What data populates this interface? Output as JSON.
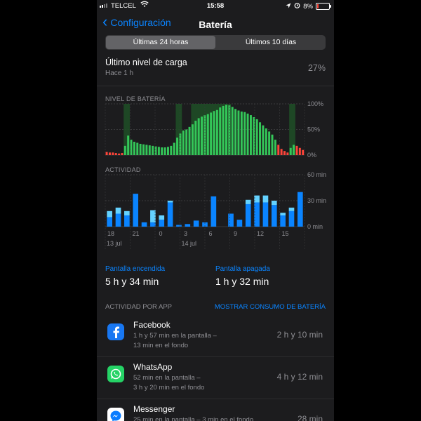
{
  "status": {
    "carrier": "TELCEL",
    "time": "15:58",
    "battery": "8%"
  },
  "nav": {
    "back_label": "Configuración",
    "title": "Batería"
  },
  "segments": {
    "last24": "Últimas 24 horas",
    "last10": "Últimos 10 días"
  },
  "charge": {
    "title": "Último nivel de carga",
    "subtitle": "Hace 1 h",
    "value": "27%"
  },
  "chart_data": [
    {
      "type": "bar",
      "title": "NIVEL DE BATERÍA",
      "ylim": [
        0,
        100
      ],
      "yticks": [
        "100%",
        "50%",
        "0%"
      ],
      "values": [
        6,
        5,
        5,
        4,
        3,
        4,
        18,
        38,
        30,
        26,
        24,
        22,
        21,
        20,
        19,
        18,
        17,
        16,
        15,
        15,
        16,
        18,
        24,
        34,
        42,
        48,
        50,
        55,
        60,
        67,
        72,
        75,
        78,
        80,
        83,
        86,
        88,
        93,
        96,
        98,
        97,
        94,
        90,
        87,
        85,
        84,
        81,
        78,
        74,
        70,
        64,
        58,
        52,
        46,
        40,
        30,
        20,
        12,
        8,
        5,
        14,
        20,
        18,
        14,
        10
      ],
      "charging_segments": [
        [
          6,
          7
        ],
        [
          23,
          24
        ],
        [
          28,
          40
        ],
        [
          60,
          61
        ]
      ],
      "grid": true
    },
    {
      "type": "bar",
      "title": "ACTIVIDAD",
      "ylim": [
        0,
        60
      ],
      "yticks": [
        "60 min",
        "30 min",
        "0 min"
      ],
      "x_ticks": [
        "18",
        "21",
        "0",
        "3",
        "6",
        "9",
        "12",
        "15"
      ],
      "date_labels": [
        "13 jul",
        "14 jul"
      ],
      "series": [
        {
          "name": "Pantalla encendida",
          "values": [
            11,
            15,
            13,
            38,
            5,
            5,
            8,
            28,
            2,
            3,
            7,
            5,
            35,
            0,
            15,
            8,
            26,
            28,
            28,
            25,
            13,
            18,
            40
          ]
        },
        {
          "name": "Pantalla apagada",
          "values": [
            7,
            7,
            5,
            0,
            0,
            14,
            5,
            2,
            0,
            0,
            0,
            0,
            0,
            0,
            0,
            0,
            5,
            8,
            8,
            5,
            3,
            4,
            0
          ]
        }
      ],
      "grid": true
    }
  ],
  "screen": {
    "on_label": "Pantalla encendida",
    "on_value": "5 h y 34 min",
    "off_label": "Pantalla apagada",
    "off_value": "1 h y 32 min"
  },
  "apps_header": {
    "title": "ACTIVIDAD POR APP",
    "link": "MOSTRAR CONSUMO DE BATERÍA"
  },
  "apps": [
    {
      "name": "Facebook",
      "line1": "1 h y 57 min en la pantalla –",
      "line2": "13 min en el fondo",
      "time": "2 h y 10 min",
      "color": "#1877f2"
    },
    {
      "name": "WhatsApp",
      "line1": "52 min en la pantalla –",
      "line2": "3 h y 20 min en el fondo",
      "time": "4 h y 12 min",
      "color": "#25d366"
    },
    {
      "name": "Messenger",
      "line1": "25 min en la pantalla – 3 min en el fondo",
      "line2": "",
      "time": "28 min",
      "color": "#0a7cff"
    }
  ],
  "colors": {
    "accent": "#0a84ff",
    "battery_green": "#34c759",
    "battery_red": "#ff453a",
    "activity_dark": "#0a84ff",
    "activity_light": "#64d2ff"
  }
}
